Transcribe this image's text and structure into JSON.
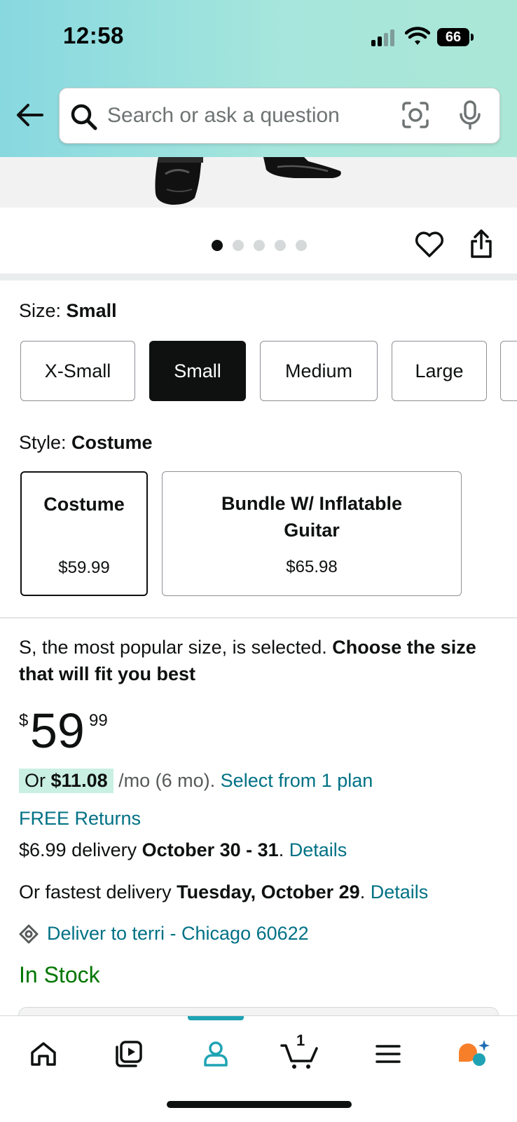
{
  "status_bar": {
    "time": "12:58",
    "battery": "66"
  },
  "search": {
    "placeholder": "Search or ask a question"
  },
  "carousel": {
    "dot_count": 5,
    "active_index": 0
  },
  "size": {
    "label": "Size:",
    "selected": "Small",
    "options": [
      "X-Small",
      "Small",
      "Medium",
      "Large"
    ]
  },
  "style": {
    "label": "Style:",
    "selected": "Costume",
    "options": [
      {
        "name": "Costume",
        "price": "$59.99"
      },
      {
        "name": "Bundle W/ Inflatable Guitar",
        "price": "$65.98"
      }
    ]
  },
  "notice": {
    "regular": "S, the most popular size, is selected.",
    "bold": "Choose the size that will fit you best"
  },
  "price": {
    "symbol": "$",
    "whole": "59",
    "fraction": "99"
  },
  "installment": {
    "prefix": "Or",
    "amount": "$11.08",
    "term": "/mo (6 mo).",
    "link": "Select from 1 plan"
  },
  "returns": "FREE Returns",
  "delivery": {
    "cost_text": "$6.99 delivery",
    "dates": "October 30 - 31",
    "details_link": "Details"
  },
  "fastest": {
    "prefix": "Or fastest delivery",
    "date": "Tuesday, October 29",
    "details_link": "Details"
  },
  "deliver_to": "Deliver to terri - Chicago 60622",
  "stock": "In Stock",
  "nav": {
    "cart_count": "1",
    "active": "account"
  },
  "colors": {
    "link": "#007185",
    "in_stock": "#007600",
    "selected_button": "#0f1111",
    "installment_highlight": "#c9f0e3",
    "nav_active": "#1fa3b4"
  }
}
